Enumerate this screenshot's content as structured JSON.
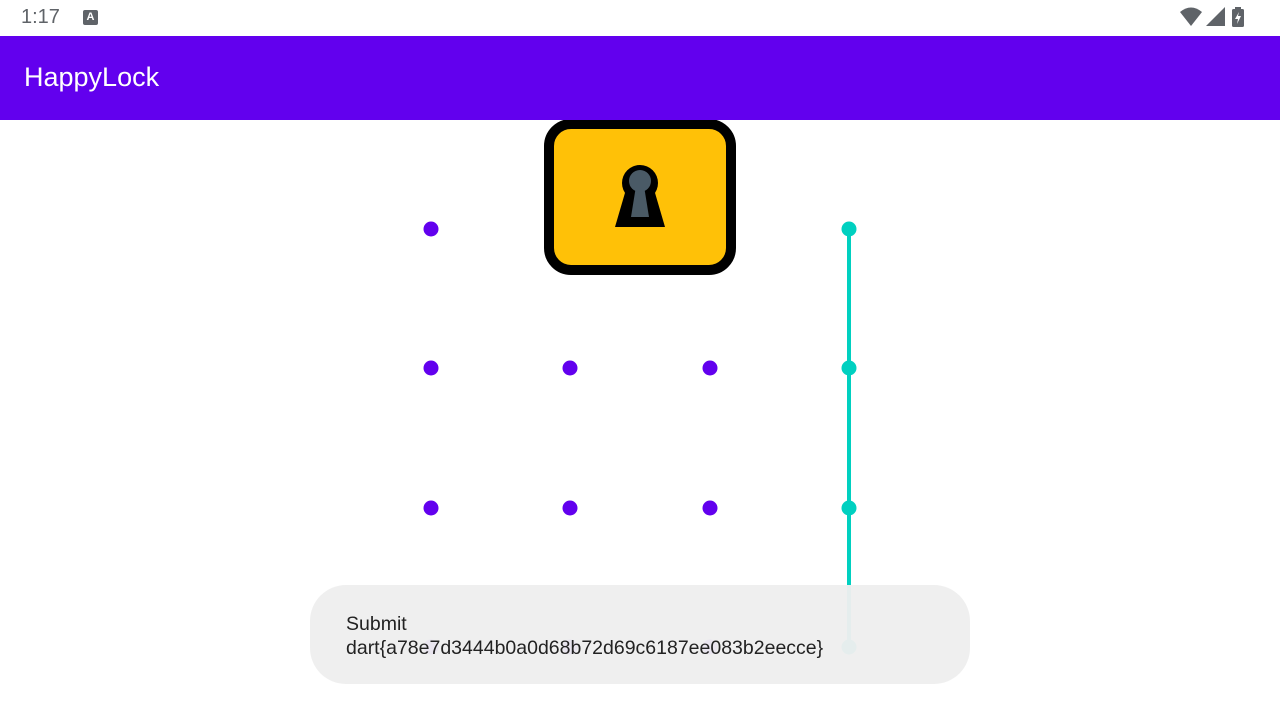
{
  "status_bar": {
    "time": "1:17",
    "notification_icon": "A",
    "icons": [
      "wifi-icon",
      "signal-icon",
      "battery-charging-icon"
    ]
  },
  "app_bar": {
    "title": "HappyLock"
  },
  "lock_icon": {
    "name": "padlock-keyhole-icon",
    "body_color": "#ffc107",
    "outline_color": "#000000",
    "keyhole_color": "#4a5a66"
  },
  "pattern": {
    "dot_color": "#6200ee",
    "active_color": "#00d0c0",
    "selected_path": [
      3,
      7,
      11,
      15
    ],
    "grid_size": 4
  },
  "toast": {
    "text": "Submit\ndart{a78e7d3444b0a0d68b72d69c6187ee083b2eecce}"
  }
}
